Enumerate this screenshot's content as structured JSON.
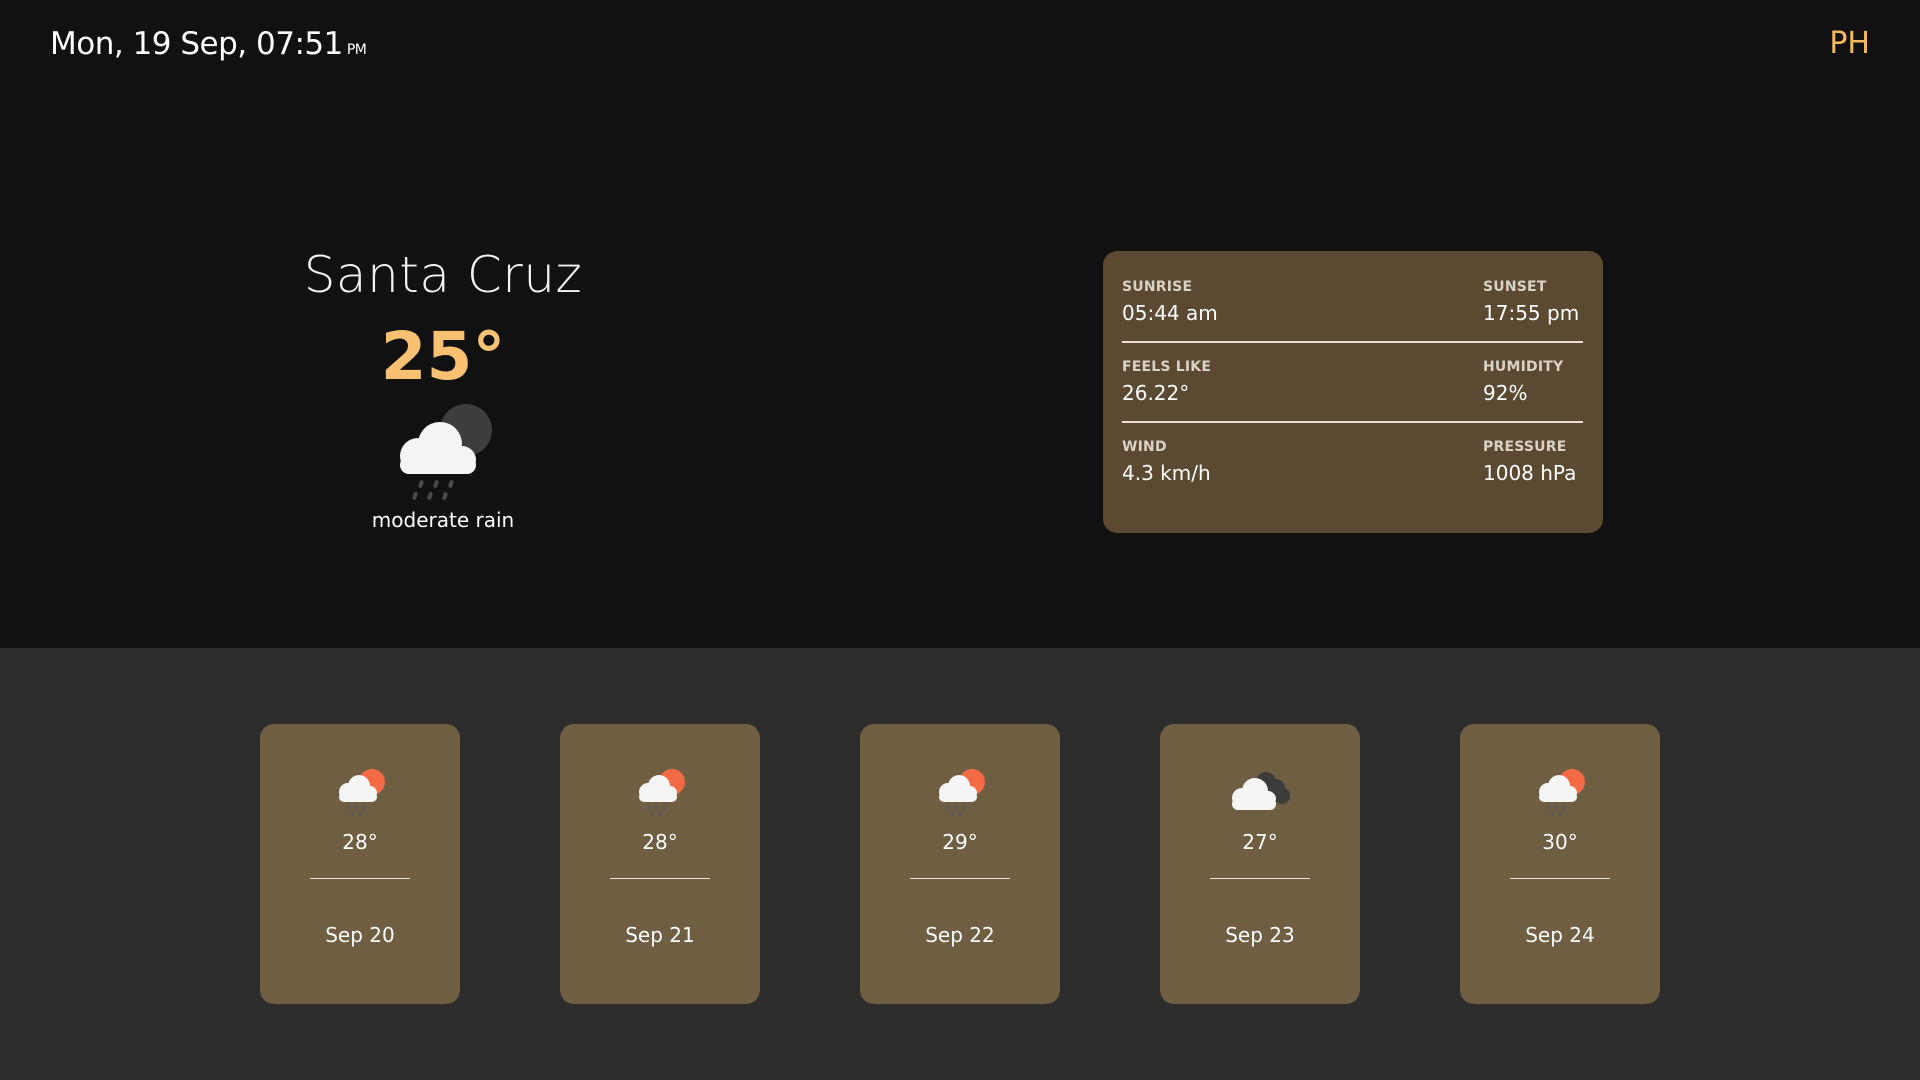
{
  "header": {
    "datetime": "Mon, 19 Sep, 07:51",
    "ampm": "PM",
    "country": "PH"
  },
  "current": {
    "city": "Santa Cruz",
    "temperature": "25°",
    "description": "moderate rain",
    "icon": "cloud-moon-rain-icon"
  },
  "details": {
    "sunrise_label": "SUNRISE",
    "sunrise": "05:44 am",
    "sunset_label": "SUNSET",
    "sunset": "17:55 pm",
    "feels_like_label": "FEELS LIKE",
    "feels_like": "26.22°",
    "humidity_label": "HUMIDITY",
    "humidity": "92%",
    "wind_label": "WIND",
    "wind": "4.3 km/h",
    "pressure_label": "PRESSURE",
    "pressure": "1008 hPa"
  },
  "forecast": [
    {
      "temp": "28°",
      "date": "Sep 20",
      "icon": "cloud-sun-rain-icon"
    },
    {
      "temp": "28°",
      "date": "Sep 21",
      "icon": "cloud-sun-rain-icon"
    },
    {
      "temp": "29°",
      "date": "Sep 22",
      "icon": "cloud-sun-rain-icon"
    },
    {
      "temp": "27°",
      "date": "Sep 23",
      "icon": "cloudy-icon"
    },
    {
      "temp": "30°",
      "date": "Sep 24",
      "icon": "cloud-sun-rain-icon"
    }
  ],
  "colors": {
    "accent": "#f9c171",
    "top_bg": "#111111",
    "bottom_bg": "#2d2d2d",
    "details_bg": "#5b4a31",
    "card_bg": "#6f5e42",
    "sun": "#f26b45"
  }
}
